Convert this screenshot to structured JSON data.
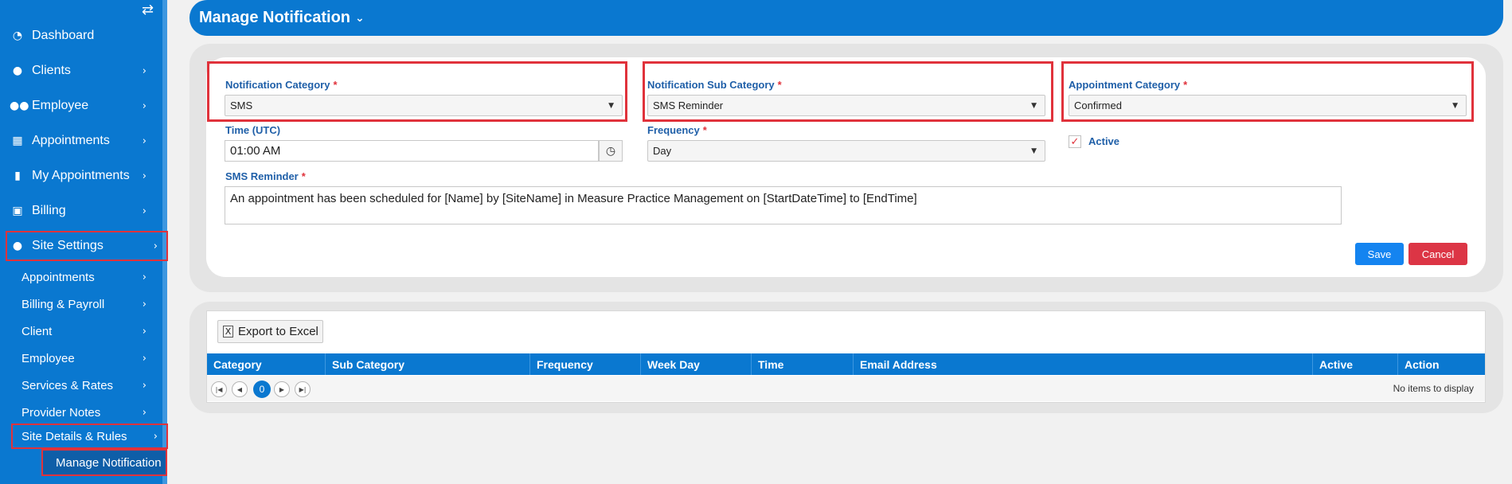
{
  "sidebar": {
    "toggle_icon": "swap-arrows-icon",
    "items": [
      {
        "label": "Dashboard",
        "icon": "dashboard-icon"
      },
      {
        "label": "Clients",
        "icon": "user-icon"
      },
      {
        "label": "Employee",
        "icon": "users-icon"
      },
      {
        "label": "Appointments",
        "icon": "calendar-icon"
      },
      {
        "label": "My Appointments",
        "icon": "bookmark-icon"
      },
      {
        "label": "Billing",
        "icon": "money-icon"
      },
      {
        "label": "Site Settings",
        "icon": "user-icon"
      }
    ],
    "sub_items": [
      {
        "label": "Appointments"
      },
      {
        "label": "Billing & Payroll"
      },
      {
        "label": "Client"
      },
      {
        "label": "Employee"
      },
      {
        "label": "Services & Rates"
      },
      {
        "label": "Provider Notes"
      },
      {
        "label": "Site Details & Rules"
      }
    ],
    "active_sub_item": "Manage Notification"
  },
  "header": {
    "title": "Manage Notification"
  },
  "form": {
    "notification_category": {
      "label": "Notification Category",
      "value": "SMS"
    },
    "notification_sub_category": {
      "label": "Notification Sub Category",
      "value": "SMS Reminder"
    },
    "appointment_category": {
      "label": "Appointment Category",
      "value": "Confirmed"
    },
    "time": {
      "label": "Time (UTC)",
      "value": "01:00 AM"
    },
    "frequency": {
      "label": "Frequency",
      "value": "Day"
    },
    "active": {
      "label": "Active",
      "checked": true
    },
    "sms_reminder": {
      "label": "SMS Reminder",
      "value": "An appointment has been scheduled for [Name] by [SiteName] in Measure Practice Management on [StartDateTime] to [EndTime]"
    },
    "required_mark": "*",
    "save_label": "Save",
    "cancel_label": "Cancel"
  },
  "grid": {
    "export_label": "Export to Excel",
    "columns": [
      "Category",
      "Sub Category",
      "Frequency",
      "Week Day",
      "Time",
      "Email Address",
      "Active",
      "Action"
    ],
    "current_page": "0",
    "empty_text": "No items to display"
  },
  "colors": {
    "primary": "#0a78d0",
    "highlight": "#e0323b",
    "save": "#1484f0",
    "cancel": "#dc3545"
  }
}
